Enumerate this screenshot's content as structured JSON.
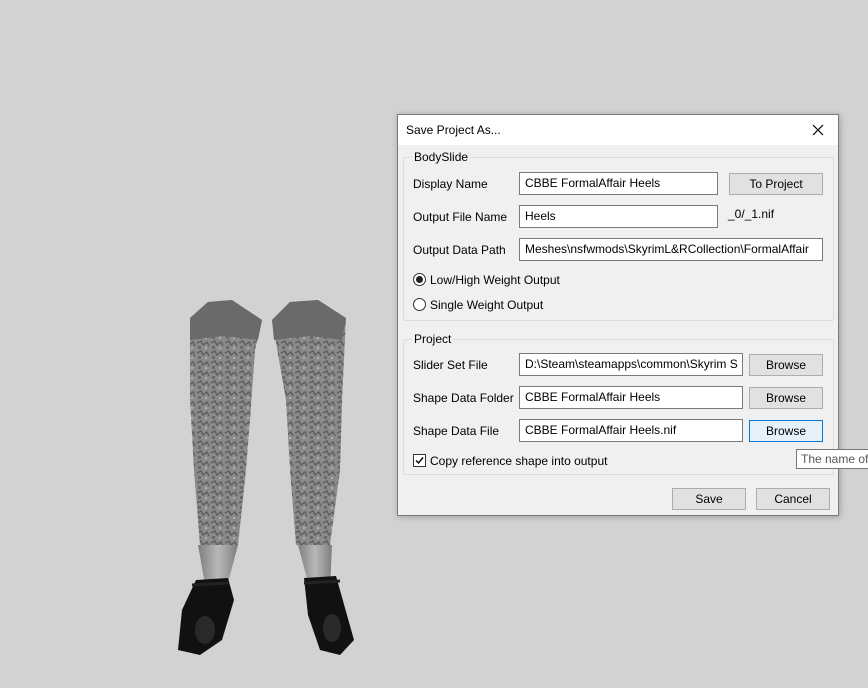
{
  "dialog": {
    "title": "Save Project As..."
  },
  "bodyslide": {
    "group_label": "BodySlide",
    "display_name_label": "Display Name",
    "display_name_value": "CBBE FormalAffair Heels",
    "to_project_label": "To Project",
    "output_file_label": "Output File Name",
    "output_file_value": "Heels",
    "output_suffix": "_0/_1.nif",
    "output_path_label": "Output Data Path",
    "output_path_value": "Meshes\\nsfwmods\\SkyrimL&RCollection\\FormalAffair",
    "low_high_label": "Low/High Weight Output",
    "single_weight_label": "Single Weight Output",
    "low_high_selected": true
  },
  "project": {
    "group_label": "Project",
    "slider_set_label": "Slider Set File",
    "slider_set_value": "D:\\Steam\\steamapps\\common\\Skyrim S",
    "shape_folder_label": "Shape Data Folder",
    "shape_folder_value": "CBBE FormalAffair Heels",
    "shape_file_label": "Shape Data File",
    "shape_file_value": "CBBE FormalAffair Heels.nif",
    "browse_label": "Browse",
    "copy_ref_label": "Copy reference shape into output",
    "copy_ref_checked": true
  },
  "footer": {
    "save_label": "Save",
    "cancel_label": "Cancel"
  },
  "tooltip": {
    "text": "The name of"
  },
  "colors": {
    "viewport_bg": "#d2d2d2",
    "dialog_bg": "#f0f0f0",
    "focus_blue": "#0078d7"
  }
}
